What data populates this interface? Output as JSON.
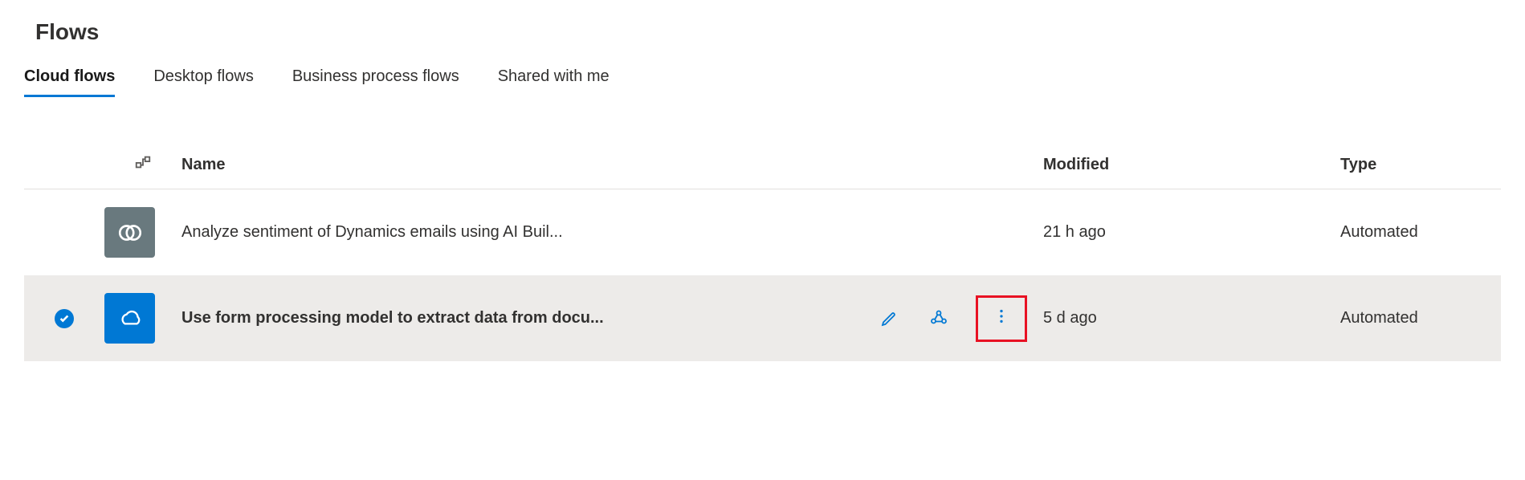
{
  "pageTitle": "Flows",
  "tabs": [
    {
      "label": "Cloud flows",
      "active": true
    },
    {
      "label": "Desktop flows",
      "active": false
    },
    {
      "label": "Business process flows",
      "active": false
    },
    {
      "label": "Shared with me",
      "active": false
    }
  ],
  "columns": {
    "name": "Name",
    "modified": "Modified",
    "type": "Type"
  },
  "rows": [
    {
      "selected": false,
      "iconStyle": "gray",
      "iconName": "dynamics-icon",
      "name": "Analyze sentiment of Dynamics emails using AI Buil...",
      "modified": "21 h ago",
      "type": "Automated",
      "showActions": false,
      "highlightMore": false
    },
    {
      "selected": true,
      "iconStyle": "blue",
      "iconName": "onedrive-icon",
      "name": "Use form processing model to extract data from docu...",
      "modified": "5 d ago",
      "type": "Automated",
      "showActions": true,
      "highlightMore": true
    }
  ],
  "colors": {
    "accent": "#0078d4",
    "highlightBorder": "#e81123"
  }
}
